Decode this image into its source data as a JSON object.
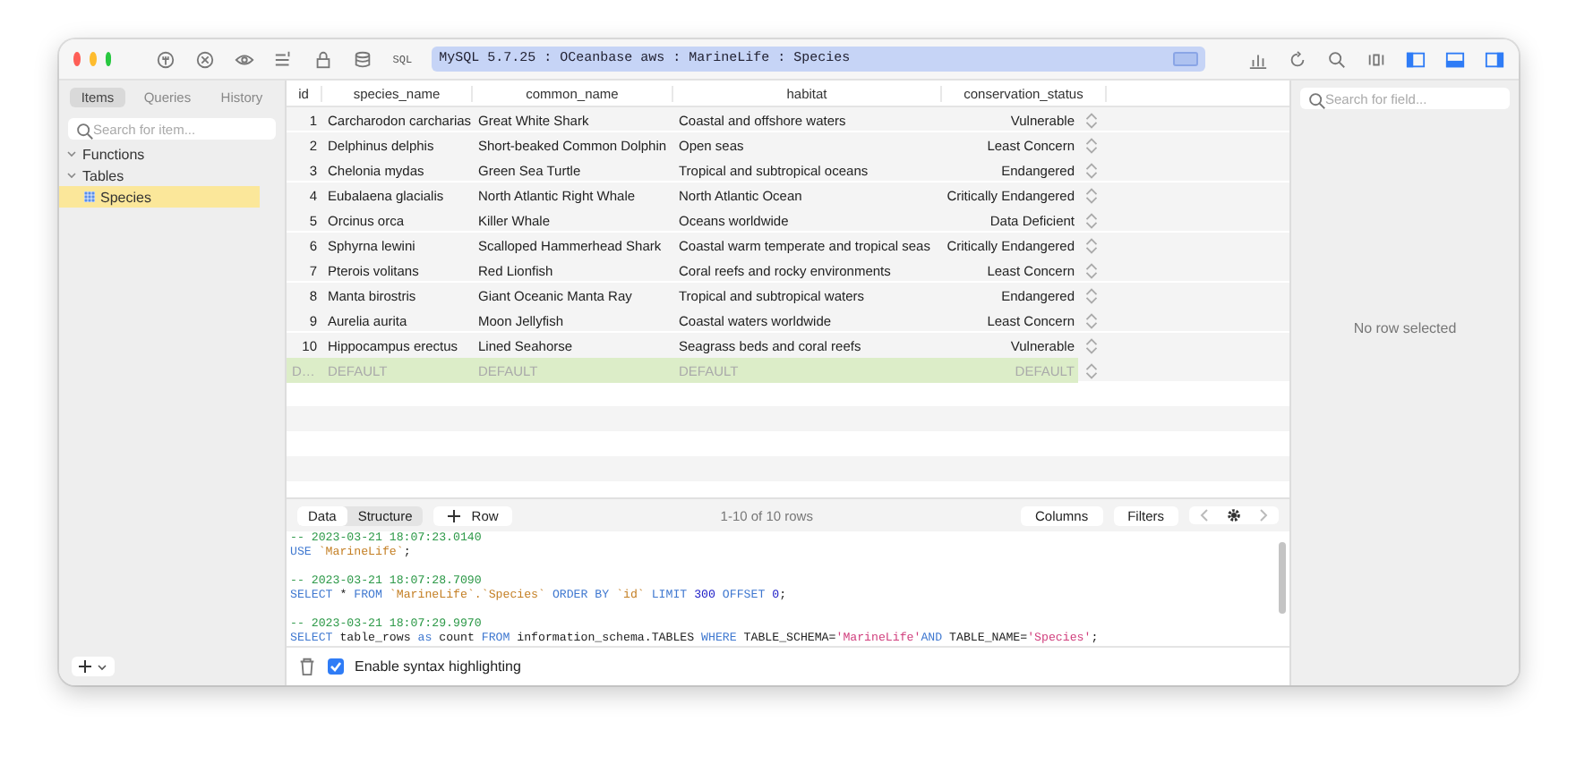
{
  "toolbar": {
    "sql_label": "SQL",
    "connection": "MySQL 5.7.25 : OCeanbase aws : MarineLife : Species"
  },
  "sidebar": {
    "tabs": [
      {
        "label": "Items",
        "selected": true
      },
      {
        "label": "Queries",
        "selected": false
      },
      {
        "label": "History",
        "selected": false
      }
    ],
    "search": {
      "placeholder": "Search for item..."
    },
    "tree": [
      {
        "label": "Functions",
        "kind": "folder",
        "expanded": true,
        "selected": false
      },
      {
        "label": "Tables",
        "kind": "folder",
        "expanded": true,
        "selected": false,
        "children": [
          {
            "label": "Species",
            "kind": "table",
            "selected": true
          }
        ]
      }
    ]
  },
  "table": {
    "columns": [
      "id",
      "species_name",
      "common_name",
      "habitat",
      "conservation_status"
    ],
    "rows": [
      [
        "1",
        "Carcharodon carcharias",
        "Great White Shark",
        "Coastal and offshore waters",
        "Vulnerable"
      ],
      [
        "2",
        "Delphinus delphis",
        "Short-beaked Common Dolphin",
        "Open seas",
        "Least Concern"
      ],
      [
        "3",
        "Chelonia mydas",
        "Green Sea Turtle",
        "Tropical and subtropical oceans",
        "Endangered"
      ],
      [
        "4",
        "Eubalaena glacialis",
        "North Atlantic Right Whale",
        "North Atlantic Ocean",
        "Critically Endangered"
      ],
      [
        "5",
        "Orcinus orca",
        "Killer Whale",
        "Oceans worldwide",
        "Data Deficient"
      ],
      [
        "6",
        "Sphyrna lewini",
        "Scalloped Hammerhead Shark",
        "Coastal warm temperate and tropical seas",
        "Critically Endangered"
      ],
      [
        "7",
        "Pterois volitans",
        "Red Lionfish",
        "Coral reefs and rocky environments",
        "Least Concern"
      ],
      [
        "8",
        "Manta birostris",
        "Giant Oceanic Manta Ray",
        "Tropical and subtropical waters",
        "Endangered"
      ],
      [
        "9",
        "Aurelia aurita",
        "Moon Jellyfish",
        "Coastal waters worldwide",
        "Least Concern"
      ],
      [
        "10",
        "Hippocampus erectus",
        "Lined Seahorse",
        "Seagrass beds and coral reefs",
        "Vulnerable"
      ]
    ],
    "new_row": [
      "D…",
      "DEFAULT",
      "DEFAULT",
      "DEFAULT",
      "DEFAULT"
    ]
  },
  "bottom_bar": {
    "tabs": [
      {
        "label": "Data",
        "selected": true
      },
      {
        "label": "Structure",
        "selected": false
      }
    ],
    "add_row": "Row",
    "status": "1-10 of 10 rows",
    "buttons": [
      "Columns",
      "Filters"
    ]
  },
  "log": [
    {
      "comment": "-- 2023-03-21 18:07:23.0140",
      "tokens": [
        {
          "text": "USE ",
          "kind": "keyword"
        },
        {
          "text": "`MarineLife`",
          "kind": "identifier"
        },
        {
          "text": ";",
          "kind": "plain"
        }
      ]
    },
    {
      "comment": "-- 2023-03-21 18:07:28.7090",
      "tokens": [
        {
          "text": "SELECT",
          "kind": "keyword"
        },
        {
          "text": " * ",
          "kind": "plain"
        },
        {
          "text": "FROM ",
          "kind": "keyword"
        },
        {
          "text": "`MarineLife`.`Species`",
          "kind": "identifier"
        },
        {
          "text": " ORDER BY ",
          "kind": "keyword"
        },
        {
          "text": "`id`",
          "kind": "identifier"
        },
        {
          "text": " LIMIT ",
          "kind": "keyword"
        },
        {
          "text": "300",
          "kind": "number"
        },
        {
          "text": " OFFSET ",
          "kind": "keyword"
        },
        {
          "text": "0",
          "kind": "number"
        },
        {
          "text": ";",
          "kind": "plain"
        }
      ]
    },
    {
      "comment": "-- 2023-03-21 18:07:29.9970",
      "tokens": [
        {
          "text": "SELECT",
          "kind": "keyword"
        },
        {
          "text": " table_rows ",
          "kind": "plain"
        },
        {
          "text": "as",
          "kind": "keyword"
        },
        {
          "text": " count ",
          "kind": "plain"
        },
        {
          "text": "FROM",
          "kind": "keyword"
        },
        {
          "text": " information_schema.TABLES ",
          "kind": "plain"
        },
        {
          "text": "WHERE",
          "kind": "keyword"
        },
        {
          "text": " TABLE_SCHEMA=",
          "kind": "plain"
        },
        {
          "text": "'MarineLife'",
          "kind": "string"
        },
        {
          "text": "AND",
          "kind": "keyword"
        },
        {
          "text": " TABLE_NAME=",
          "kind": "plain"
        },
        {
          "text": "'Species'",
          "kind": "string"
        },
        {
          "text": ";",
          "kind": "plain"
        }
      ]
    }
  ],
  "syntax_highlighting": {
    "label": "Enable syntax highlighting",
    "checked": true
  },
  "details": {
    "search": {
      "placeholder": "Search for field..."
    },
    "empty_text": "No row selected"
  }
}
